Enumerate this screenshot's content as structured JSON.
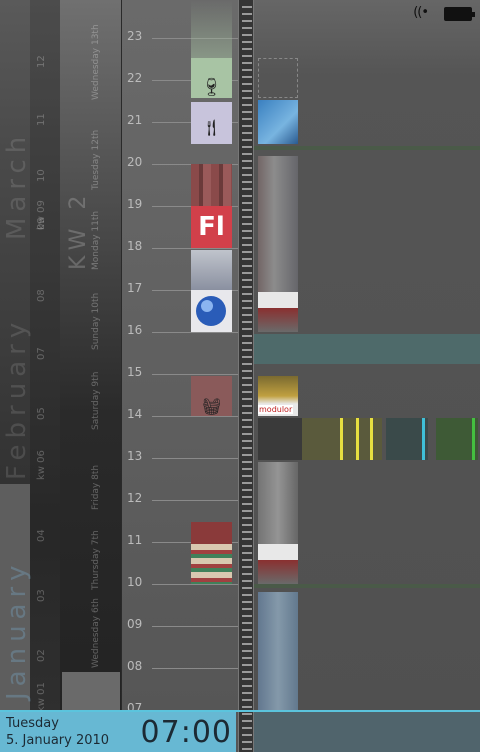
{
  "status_bar": {
    "wifi_icon": "wifi-icon",
    "battery_icon": "battery-icon"
  },
  "months": {
    "march": "March",
    "february": "February",
    "january": "January"
  },
  "week_numbers": [
    "kw 09",
    "kw 06",
    "kw 01"
  ],
  "day_numbers": [
    "12",
    "11",
    "10",
    "09",
    "08",
    "07",
    "05",
    "04",
    "03",
    "02"
  ],
  "kw_label": "KW 2",
  "week_days": [
    {
      "name": "Wednesday",
      "date": "13th"
    },
    {
      "name": "Tuesday",
      "date": "12th"
    },
    {
      "name": "Monday",
      "date": "11th"
    },
    {
      "name": "Sunday",
      "date": "10th"
    },
    {
      "name": "Saturday",
      "date": "9th"
    },
    {
      "name": "Friday",
      "date": "8th"
    },
    {
      "name": "Thursday",
      "date": "7th"
    },
    {
      "name": "Wednesday",
      "date": "6th"
    }
  ],
  "hours": [
    "23",
    "22",
    "21",
    "20",
    "19",
    "18",
    "17",
    "16",
    "15",
    "14",
    "13",
    "12",
    "11",
    "10",
    "09",
    "08",
    "07"
  ],
  "events": [
    {
      "name": "Drinks",
      "icon": "wine-glass-icon",
      "color": "#a8c4a4"
    },
    {
      "name": "Dinner",
      "icon": "fork-knife-icon",
      "color": "#c8c4dc"
    },
    {
      "name": "Block",
      "icon": "stripe-icon",
      "color": "#8a4a4a"
    },
    {
      "name": "Flash",
      "icon": "fl-icon",
      "label": "Fl",
      "color": "#d2404a"
    },
    {
      "name": "App",
      "icon": "app-icon",
      "color": "#e8e8ec"
    },
    {
      "name": "Shopping",
      "icon": "basket-icon",
      "color": "#8a5a5a"
    },
    {
      "name": "Bookshelf",
      "icon": "bookshelf-icon",
      "color": "#8a3a3a"
    }
  ],
  "photos": [
    "building-photo",
    "storefront-photo",
    "shop-photo",
    "storefront-photo-2"
  ],
  "shop_sign": "modulor",
  "bars": [
    {
      "color": "#3a3a3a"
    },
    {
      "color": "#5a5a3c",
      "marker": "#e8e040"
    },
    {
      "color": "#3a4a4a",
      "marker": "#40c0d8"
    },
    {
      "color": "#3e5a36",
      "marker": "#44c040"
    }
  ],
  "current": {
    "weekday": "Tuesday",
    "date": "5. January 2010",
    "time": "07:00"
  },
  "colors": {
    "accent": "#5bc4dd",
    "bottom_bg": "#67b8d3"
  }
}
